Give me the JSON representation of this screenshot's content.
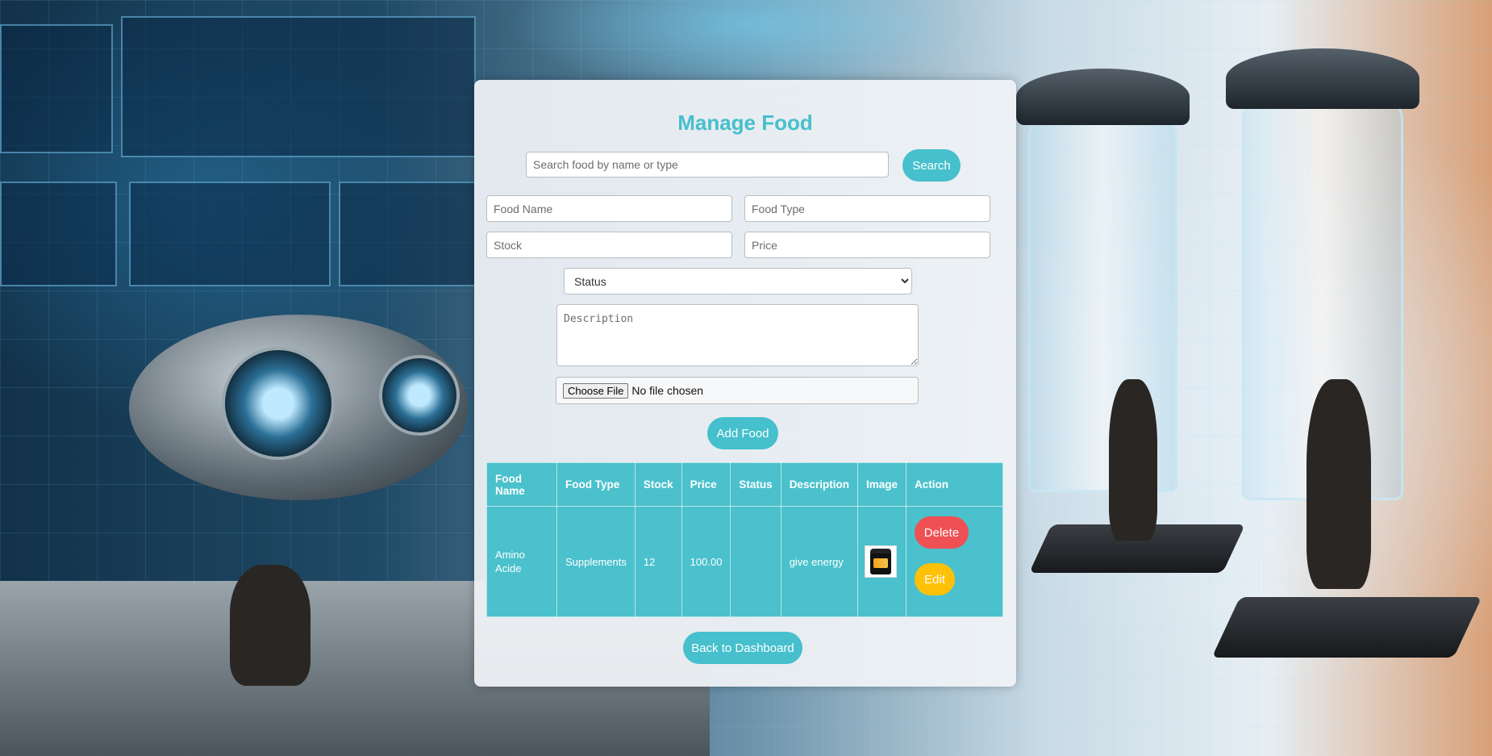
{
  "page": {
    "title": "Manage Food"
  },
  "search": {
    "placeholder": "Search food by name or type",
    "value": "",
    "button_label": "Search"
  },
  "form": {
    "food_name_placeholder": "Food Name",
    "food_type_placeholder": "Food Type",
    "stock_placeholder": "Stock",
    "price_placeholder": "Price",
    "status_selected": "Status",
    "description_placeholder": "Description",
    "file": {
      "button_label": "Choose File",
      "status_text": "No file chosen"
    },
    "submit_label": "Add Food"
  },
  "table": {
    "headers": {
      "food_name": "Food Name",
      "food_type": "Food Type",
      "stock": "Stock",
      "price": "Price",
      "status": "Status",
      "description": "Description",
      "image": "Image",
      "action": "Action"
    },
    "rows": [
      {
        "food_name": "Amino Acide",
        "food_type": "Supplements",
        "stock": "12",
        "price": "100.00",
        "status": "",
        "description": "give energy",
        "image_icon": "supplement-jar-icon",
        "delete_label": "Delete",
        "edit_label": "Edit"
      }
    ]
  },
  "footer": {
    "back_label": "Back to Dashboard"
  },
  "colors": {
    "accent": "#45c0cc",
    "danger": "#ee5053",
    "warning": "#ffc107",
    "card_bg": "#f0f3f6"
  }
}
